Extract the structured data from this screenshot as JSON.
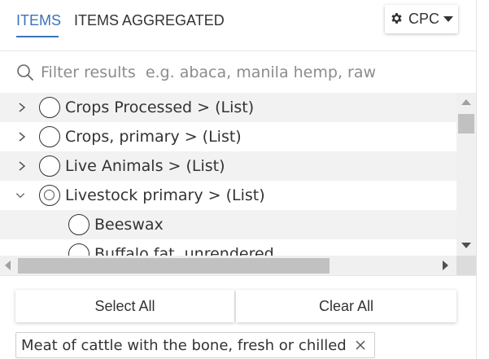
{
  "tabs": [
    {
      "label": "ITEMS",
      "active": true
    },
    {
      "label": "ITEMS AGGREGATED",
      "active": false
    }
  ],
  "classification": {
    "label": "CPC",
    "icon": "gear-icon",
    "dropdown_icon": "caret-down-icon"
  },
  "search": {
    "placeholder": "Filter results  e.g. abaca, manila hemp, raw",
    "value": ""
  },
  "tree": [
    {
      "label": "Crops Processed > (List)",
      "state": "collapsed",
      "selection": "none",
      "level": 0
    },
    {
      "label": "Crops, primary > (List)",
      "state": "collapsed",
      "selection": "none",
      "level": 0
    },
    {
      "label": "Live Animals > (List)",
      "state": "collapsed",
      "selection": "none",
      "level": 0
    },
    {
      "label": "Livestock primary > (List)",
      "state": "expanded",
      "selection": "partial",
      "level": 0
    },
    {
      "label": "Beeswax",
      "state": "leaf",
      "selection": "none",
      "level": 1
    },
    {
      "label": "Buffalo fat, unrendered",
      "state": "leaf",
      "selection": "none",
      "level": 1
    }
  ],
  "actions": {
    "select_all": "Select All",
    "clear_all": "Clear All"
  },
  "selected": [
    {
      "label": "Meat of cattle with the bone, fresh or chilled"
    }
  ],
  "colors": {
    "accent": "#3b73b9",
    "row_alt": "#f2f2f2",
    "scrollbar": "#c1c1c1"
  }
}
